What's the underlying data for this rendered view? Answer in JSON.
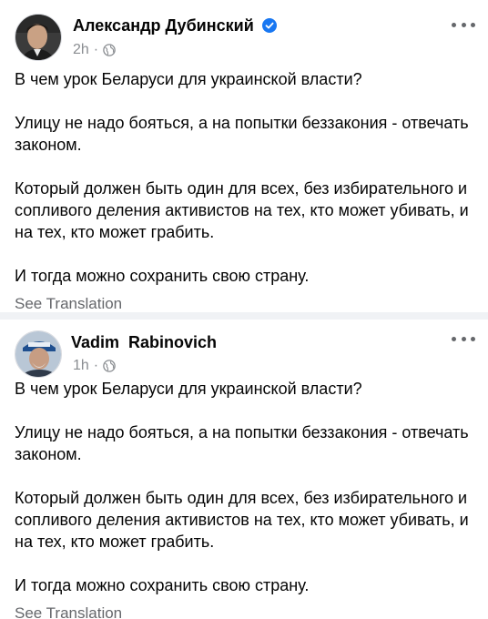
{
  "posts": [
    {
      "author": "Александр Дубинский",
      "verified": true,
      "time": "2h",
      "separator": "·",
      "privacy_icon": "globe-icon",
      "paragraphs": [
        "В чем урок Беларуси для украинской власти?",
        "Улицу не надо бояться, а на попытки беззакония - отвечать законом.",
        "Который должен быть один для всех, без избирательного и сопливого деления активистов на тех, кто может убивать, и на тех, кто может грабить.",
        "И тогда можно сохранить свою страну."
      ],
      "see_translation": "See Translation"
    },
    {
      "author": "Vadim  Rabinovich",
      "verified": false,
      "time": "1h",
      "separator": "·",
      "privacy_icon": "globe-icon",
      "paragraphs": [
        "В чем урок Беларуси для украинской власти?",
        "Улицу не надо бояться, а на попытки беззакония - отвечать законом.",
        "Который должен быть один для всех, без избирательного и сопливого деления активистов на тех, кто может убивать, и на тех, кто может грабить.",
        "И тогда можно сохранить свою страну."
      ],
      "see_translation": "See Translation"
    }
  ],
  "colors": {
    "text": "#050505",
    "muted": "#65676b",
    "meta": "#8a8d91",
    "verified": "#1877f2",
    "separator": "#f0f2f5"
  }
}
